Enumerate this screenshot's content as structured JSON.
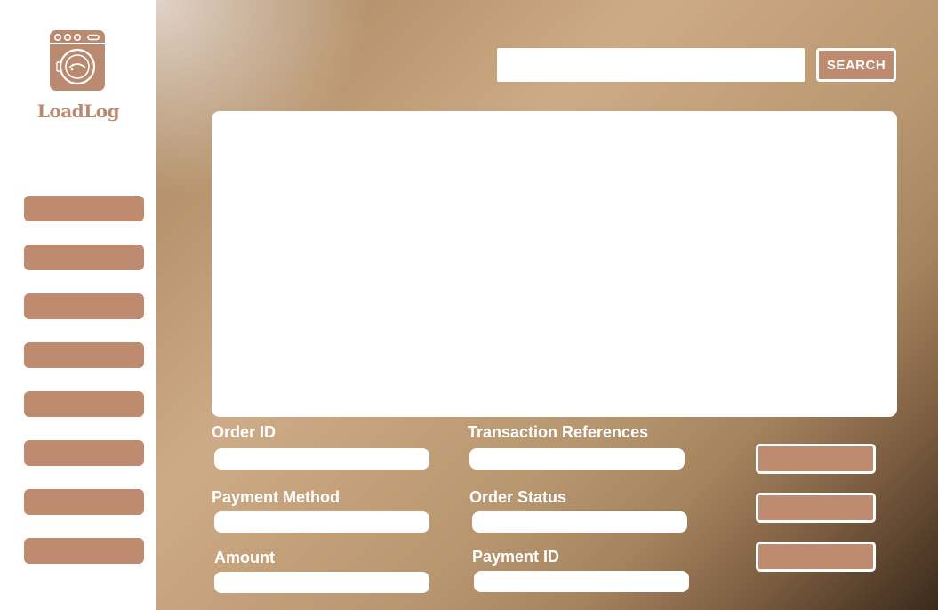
{
  "app": {
    "name": "LoadLog",
    "brand_color": "#be8b70",
    "logo_icon": "washing-machine-icon"
  },
  "sidebar": {
    "items": [
      {
        "label": ""
      },
      {
        "label": ""
      },
      {
        "label": ""
      },
      {
        "label": ""
      },
      {
        "label": ""
      },
      {
        "label": ""
      },
      {
        "label": ""
      },
      {
        "label": ""
      }
    ]
  },
  "search": {
    "value": "",
    "placeholder": "",
    "button_label": "SEARCH"
  },
  "form": {
    "order_id": {
      "label": "Order ID",
      "value": ""
    },
    "transaction_references": {
      "label": "Transaction References",
      "value": ""
    },
    "payment_method": {
      "label": "Payment Method",
      "value": ""
    },
    "order_status": {
      "label": "Order Status",
      "value": ""
    },
    "amount": {
      "label": "Amount",
      "value": ""
    },
    "payment_id": {
      "label": "Payment ID",
      "value": ""
    }
  },
  "actions": [
    {
      "label": ""
    },
    {
      "label": ""
    },
    {
      "label": ""
    }
  ]
}
